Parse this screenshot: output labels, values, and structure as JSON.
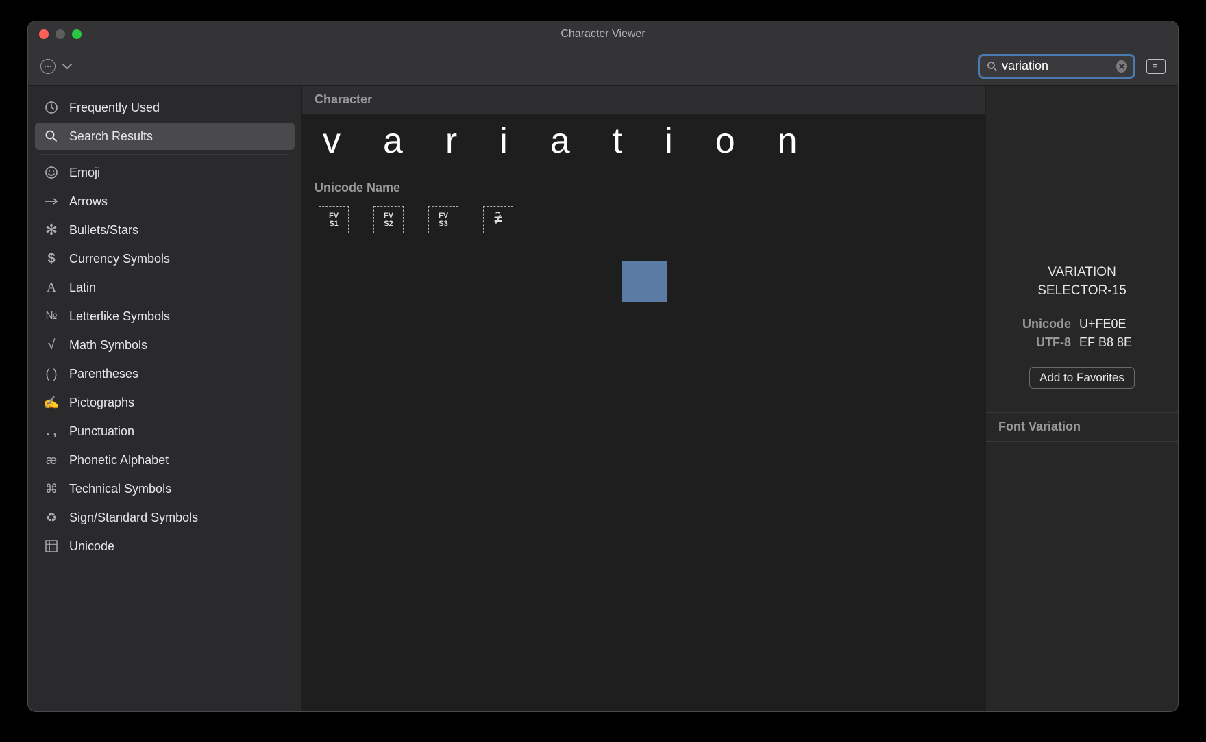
{
  "window": {
    "title": "Character Viewer"
  },
  "search": {
    "value": "variation",
    "placeholder": "Search"
  },
  "sidebar": {
    "top_items": [
      {
        "label": "Frequently Used",
        "icon_name": "clock-icon"
      },
      {
        "label": "Search Results",
        "icon_name": "search-icon"
      }
    ],
    "selected_index": 1,
    "categories": [
      {
        "label": "Emoji",
        "icon_name": "emoji-icon"
      },
      {
        "label": "Arrows",
        "icon_name": "arrow-icon"
      },
      {
        "label": "Bullets/Stars",
        "icon_name": "asterisk-icon"
      },
      {
        "label": "Currency Symbols",
        "icon_name": "dollar-icon"
      },
      {
        "label": "Latin",
        "icon_name": "latin-a-icon"
      },
      {
        "label": "Letterlike Symbols",
        "icon_name": "numero-icon"
      },
      {
        "label": "Math Symbols",
        "icon_name": "sqrt-icon"
      },
      {
        "label": "Parentheses",
        "icon_name": "parens-icon"
      },
      {
        "label": "Pictographs",
        "icon_name": "write-icon"
      },
      {
        "label": "Punctuation",
        "icon_name": "punct-icon"
      },
      {
        "label": "Phonetic Alphabet",
        "icon_name": "ae-icon"
      },
      {
        "label": "Technical Symbols",
        "icon_name": "command-icon"
      },
      {
        "label": "Sign/Standard Symbols",
        "icon_name": "recycle-icon"
      },
      {
        "label": "Unicode",
        "icon_name": "grid-icon"
      }
    ]
  },
  "main": {
    "character_header": "Character",
    "query_chars": [
      "v",
      "a",
      "r",
      "i",
      "a",
      "t",
      "i",
      "o",
      "n"
    ],
    "unicode_header": "Unicode Name",
    "results": [
      {
        "display_top": "FV",
        "display_bottom": "S1"
      },
      {
        "display_top": "FV",
        "display_bottom": "S2"
      },
      {
        "display_top": "FV",
        "display_bottom": "S3"
      },
      {
        "display_symbol": "≠̃"
      }
    ]
  },
  "detail": {
    "name_line1": "VARIATION",
    "name_line2": "SELECTOR-15",
    "unicode_label": "Unicode",
    "unicode_value": "U+FE0E",
    "utf8_label": "UTF-8",
    "utf8_value": "EF B8 8E",
    "favorites_label": "Add to Favorites",
    "font_variation_header": "Font Variation"
  }
}
